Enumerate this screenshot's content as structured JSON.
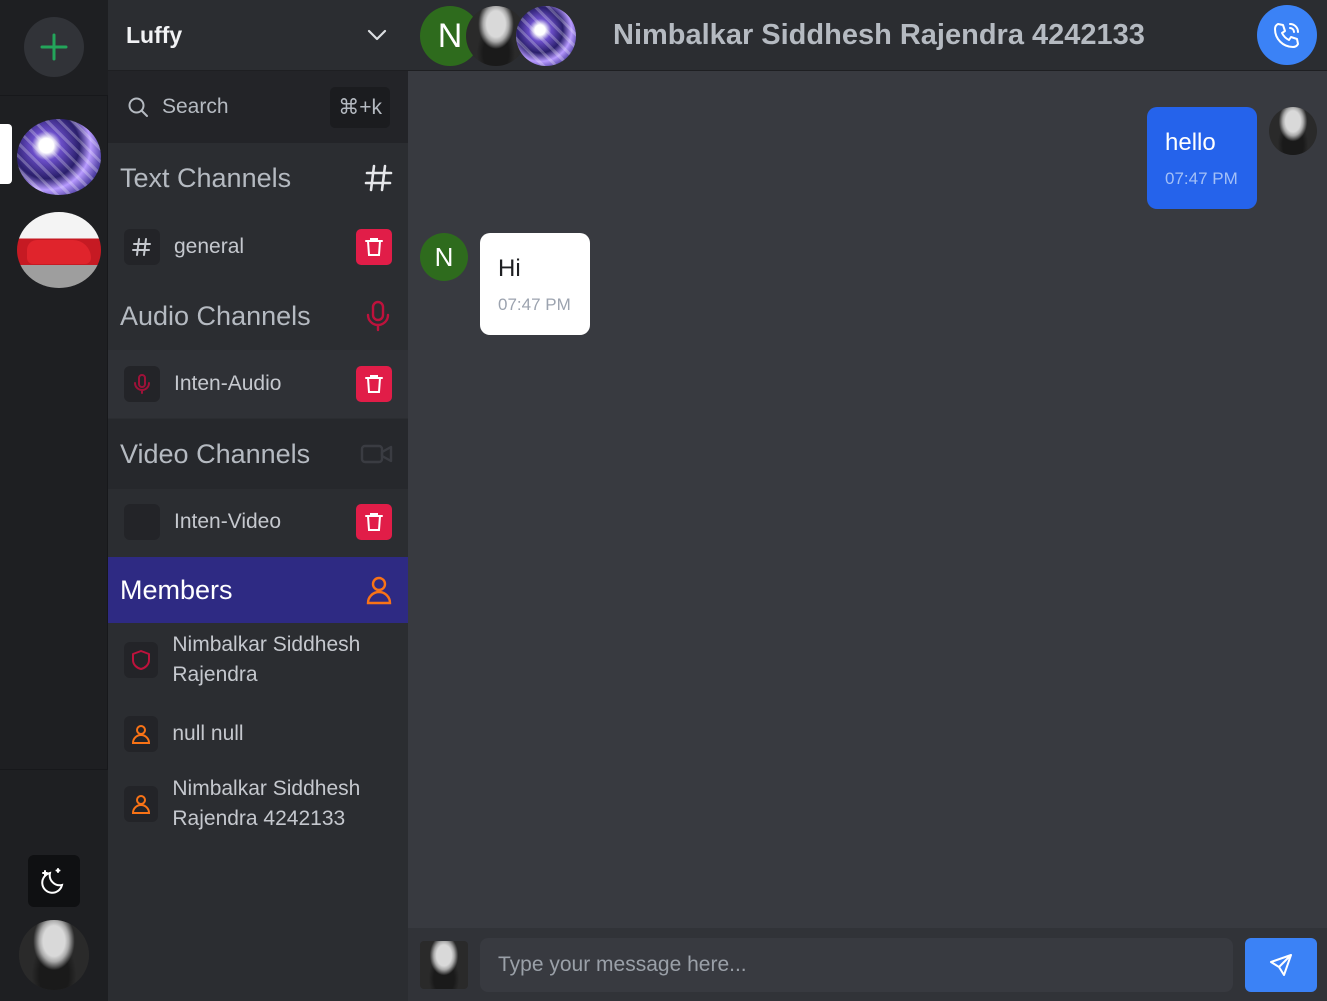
{
  "server": {
    "name": "Luffy",
    "search_label": "Search",
    "search_shortcut": "⌘+k"
  },
  "sections": {
    "text": "Text Channels",
    "audio": "Audio Channels",
    "video": "Video Channels",
    "members": "Members"
  },
  "channels": {
    "text": [
      {
        "name": "general"
      }
    ],
    "audio": [
      {
        "name": "Inten-Audio"
      }
    ],
    "video": [
      {
        "name": "Inten-Video"
      }
    ]
  },
  "members": [
    {
      "name": "Nimbalkar Siddhesh Rajendra",
      "role_icon": "shield-icon"
    },
    {
      "name": "null null",
      "role_icon": "user-icon"
    },
    {
      "name": "Nimbalkar Siddhesh Rajendra 4242133",
      "role_icon": "user-icon"
    }
  ],
  "chat": {
    "title": "Nimbalkar Siddhesh Rajendra 4242133",
    "header_avatar_initial": "N",
    "messages": [
      {
        "text": "hello",
        "time": "07:47 PM",
        "direction": "outgoing"
      },
      {
        "text": "Hi",
        "time": "07:47 PM",
        "direction": "incoming",
        "avatar_initial": "N"
      }
    ],
    "composer_placeholder": "Type your message here..."
  },
  "colors": {
    "accent_blue": "#3b82f6",
    "danger_red": "#e11d48",
    "members_highlight": "#2e2a83",
    "member_orange": "#f97316",
    "add_green": "#23a55a"
  }
}
